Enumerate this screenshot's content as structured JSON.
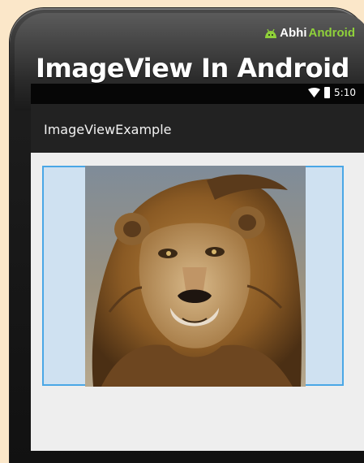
{
  "brand": {
    "part1": "Abhi",
    "part2": "Android",
    "icon": "android-icon"
  },
  "headline": "ImageView In Android",
  "status_bar": {
    "time": "5:10",
    "icons": [
      "wifi-icon",
      "battery-icon"
    ]
  },
  "action_bar": {
    "title": "ImageViewExample"
  },
  "image": {
    "subject": "lion-image"
  },
  "colors": {
    "page_background": "#fbe7c9",
    "screen_background": "#eeeeee",
    "action_bar": "#222222",
    "imageview_background": "#cfe1f1",
    "imageview_border": "#4aa7e6",
    "brand_green": "#8fd13a"
  }
}
